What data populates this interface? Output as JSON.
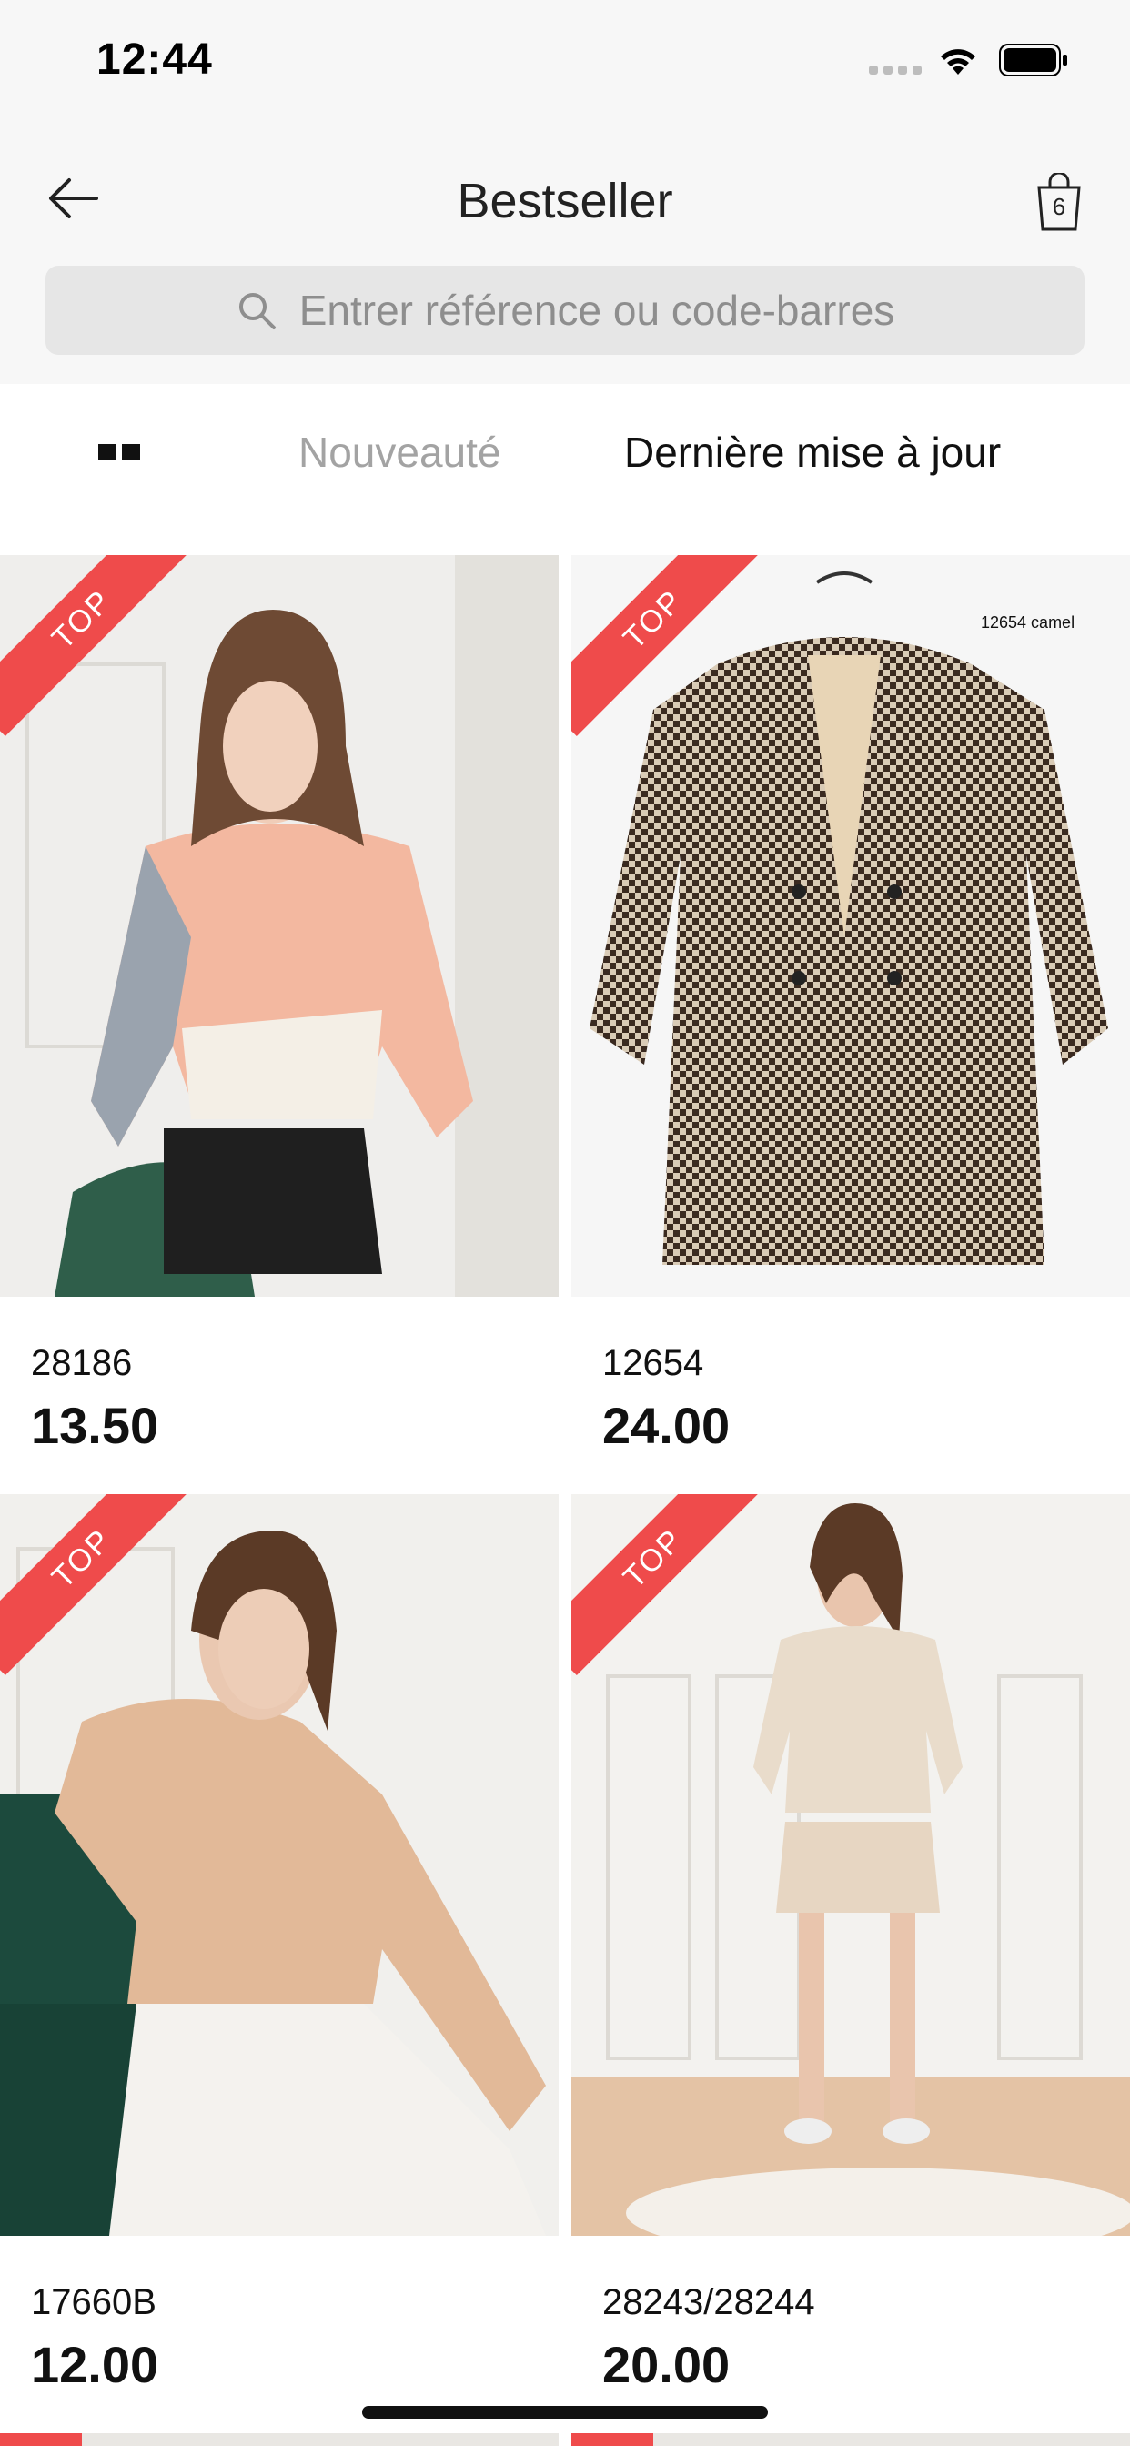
{
  "status_bar": {
    "time": "12:44"
  },
  "nav": {
    "title": "Bestseller",
    "bag_count": "6",
    "search_placeholder": "Entrer référence ou code-barres"
  },
  "filters": {
    "tab_new": "Nouveauté",
    "tab_updated": "Dernière mise à jour"
  },
  "products": [
    {
      "badge": "TOP",
      "ref": "28186",
      "price": "13.50",
      "image_desc": "sweater-image"
    },
    {
      "badge": "TOP",
      "ref": "12654",
      "price": "24.00",
      "image_desc": "coat-image",
      "image_caption": "12654 camel"
    },
    {
      "badge": "TOP",
      "ref": "17660B",
      "price": "12.00",
      "image_desc": "cardigan-image"
    },
    {
      "badge": "TOP",
      "ref": "28243/28244",
      "price": "20.00",
      "image_desc": "zebra-set-image"
    }
  ],
  "colors": {
    "badge": "#ef4b4b",
    "header_bg": "#f7f7f7",
    "search_bg": "#e6e6e6"
  }
}
